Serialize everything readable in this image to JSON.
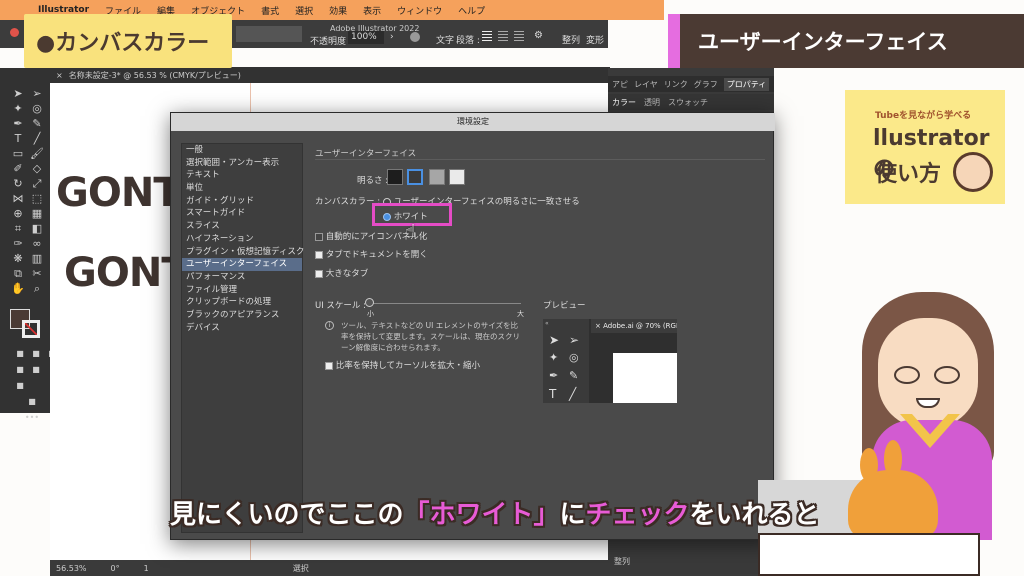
{
  "menubar": {
    "items": [
      "Illustrator",
      "ファイル",
      "編集",
      "オブジェクト",
      "書式",
      "選択",
      "効果",
      "表示",
      "ウィンドウ",
      "ヘルプ"
    ]
  },
  "controlbar": {
    "opacity_label": "不透明度 :",
    "opacity_value": "100%",
    "doc_title": "Adobe Illustrator 2022",
    "text_label": "文字",
    "paragraph_label": "段落 :",
    "align_label": "整列",
    "transform_label": "変形"
  },
  "doc_tab": {
    "label": "名称未設定-3* @ 56.53 % (CMYK/プレビュー)"
  },
  "canvas": {
    "text1": "GONT",
    "text2": "GONT"
  },
  "rightpanel": {
    "tabs": [
      "アピ",
      "レイヤ",
      "リンク",
      "グラフ",
      "プロパティ"
    ],
    "subtabs": [
      "カラー",
      "透明",
      "スウォッチ"
    ],
    "align_bottom": "整列"
  },
  "statusbar": {
    "zoom": "56.53%",
    "angle": "0°",
    "page": "1",
    "select_label": "選択"
  },
  "dialog": {
    "title": "環境設定",
    "categories": [
      "一般",
      "選択範囲・アンカー表示",
      "テキスト",
      "単位",
      "ガイド・グリッド",
      "スマートガイド",
      "スライス",
      "ハイフネーション",
      "プラグイン・仮想記憶ディスク",
      "ユーザーインターフェイス",
      "パフォーマンス",
      "ファイル管理",
      "クリップボードの処理",
      "ブラックのアピアランス",
      "デバイス"
    ],
    "selected_index": 9,
    "section_title": "ユーザーインターフェイス",
    "brightness_label": "明るさ :",
    "canvas_color_label": "カンバスカラー :",
    "canvas_option1": "ユーザーインターフェイスの明るさに一致させる",
    "canvas_option2": "ホワイト",
    "auto_icon": "自動的にアイコンパネル化",
    "open_tabs": "タブでドキュメントを開く",
    "large_tabs": "大きなタブ",
    "ui_scale_label": "UI スケール :",
    "scale_small": "小",
    "scale_large": "大",
    "info_text": "ツール、テキストなどの UI エレメントのサイズを比率を保持して変更します。スケールは、現在のスクリーン解像度に合わせられます。",
    "cursor_scale": "比率を保持してカーソルを拡大・縮小",
    "preview_label": "プレビュー",
    "preview_tab": "Adobe.ai @ 70% (RGB/"
  },
  "overlay": {
    "left_sticker": "●カンバスカラー",
    "right_sticker": "ユーザーインターフェイス",
    "yt_line1": "Tubeを見ながら学べる",
    "yt_line2": "llustratorの",
    "yt_line3": "使い方",
    "subtitle_pre": "見にくいのでここの",
    "subtitle_pink1": "「ホワイト」",
    "subtitle_mid": "に",
    "subtitle_pink2": "チェック",
    "subtitle_post": "をいれると"
  },
  "colors": {
    "accent_pink": "#e54cc6",
    "sticker_yellow": "#f9e27d",
    "sticker_brown": "#4b3a33",
    "menubar_orange": "#f5a15c",
    "selected_cat": "#5a6d8a"
  }
}
